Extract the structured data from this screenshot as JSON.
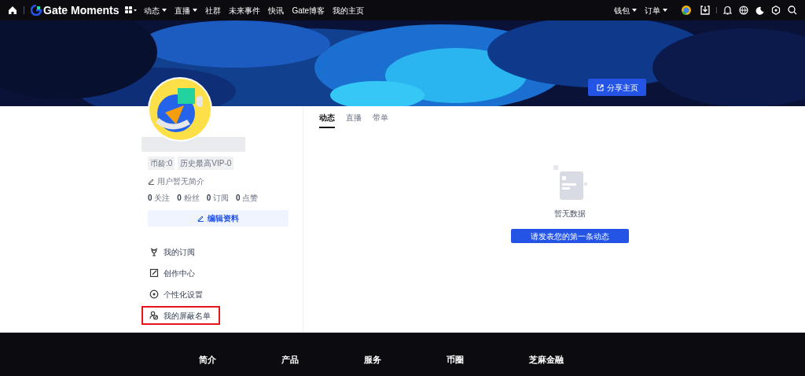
{
  "nav": {
    "logo": "Gate Moments",
    "items": [
      {
        "label": "动态",
        "dropdown": true
      },
      {
        "label": "直播",
        "dropdown": true
      },
      {
        "label": "社群",
        "dropdown": false
      },
      {
        "label": "未来事件",
        "dropdown": false
      },
      {
        "label": "快讯",
        "dropdown": false
      },
      {
        "label": "Gate博客",
        "dropdown": false
      },
      {
        "label": "我的主页",
        "dropdown": false
      }
    ],
    "right_items": [
      {
        "label": "钱包",
        "dropdown": true
      },
      {
        "label": "订单",
        "dropdown": true
      }
    ]
  },
  "banner": {
    "kind": "picture",
    "share_button": "分享主页"
  },
  "profile": {
    "badges": [
      "币龄:0",
      "历史最高VIP-0"
    ],
    "bio": "用户暂无简介",
    "stats": [
      "**0** 关注",
      "**0** 粉丝",
      "**0** 订阅",
      "**0** 点赞"
    ],
    "edit_button": "编辑资料",
    "menu": [
      {
        "kind": "subscribe",
        "label": "我的订阅",
        "highlighted": false
      },
      {
        "kind": "create",
        "label": "创作中心",
        "highlighted": false
      },
      {
        "kind": "settings",
        "label": "个性化设置",
        "highlighted": false
      },
      {
        "kind": "block",
        "label": "我的屏蔽名单",
        "highlighted": true
      }
    ]
  },
  "tabs": [
    {
      "label": "动态",
      "selected": true
    },
    {
      "label": "直播",
      "selected": false
    },
    {
      "label": "带单",
      "selected": false
    }
  ],
  "empty_state": {
    "message": "暂无数据",
    "button": "请发表您的第一条动态"
  },
  "footer": {
    "columns": [
      "简介",
      "产品",
      "服务",
      "币圈",
      "芝麻金融"
    ]
  }
}
